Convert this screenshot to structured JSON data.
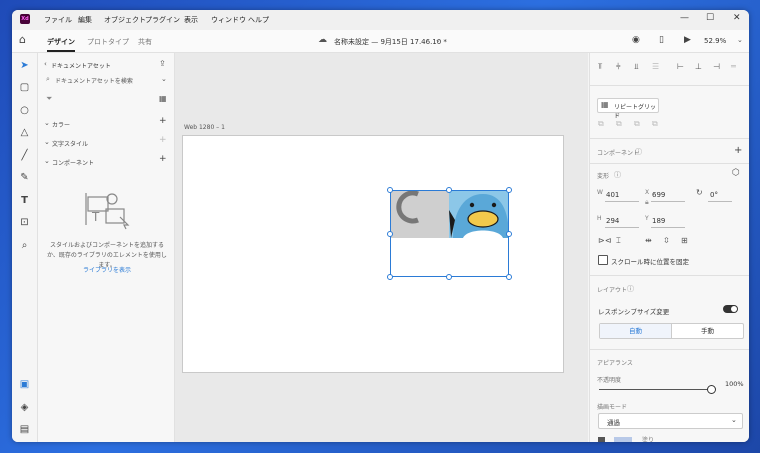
{
  "menubar": {
    "app_logo": "Xd",
    "items": [
      "ファイル",
      "編集",
      "オブジェクト",
      "プラグイン",
      "表示",
      "ウィンドウ",
      "ヘルプ"
    ]
  },
  "toolbar": {
    "tabs": [
      "デザイン",
      "プロトタイプ",
      "共有"
    ],
    "doc_title": "名称未設定 — 9月15日 17.46.10 *",
    "zoom": "52.9%"
  },
  "assets": {
    "header": "ドキュメントアセット",
    "search_placeholder": "ドキュメントアセットを検索",
    "sections": [
      "カラー",
      "文字スタイル",
      "コンポーネント"
    ],
    "empty_text": "スタイルおよびコンポーネントを追加するか、既存のライブラリのエレメントを使用します。",
    "link": "ライブラリを表示"
  },
  "canvas": {
    "artboard_label": "Web 1280 – 1"
  },
  "props": {
    "repeat_grid": "リピートグリッド",
    "component_label": "コンポーネント",
    "transform_label": "変形",
    "w_label": "W",
    "w": "401",
    "x_label": "X",
    "x": "699",
    "rotation": "0°",
    "h_label": "H",
    "h": "294",
    "y_label": "Y",
    "y": "189",
    "fix_scroll": "スクロール時に位置を固定",
    "layout_label": "レイアウト",
    "responsive": "レスポンシブサイズ変更",
    "auto": "自動",
    "manual": "手動",
    "appearance_label": "アピアランス",
    "opacity_label": "不透明度",
    "opacity": "100%",
    "blend_label": "描画モード",
    "blend_value": "通過",
    "fill_label": "塗り"
  },
  "colors": {
    "accent": "#2b7bd6",
    "penguin_bg": "#8cc7e8",
    "gray_bg": "#cfcfcf",
    "beak": "#f2c94c"
  }
}
